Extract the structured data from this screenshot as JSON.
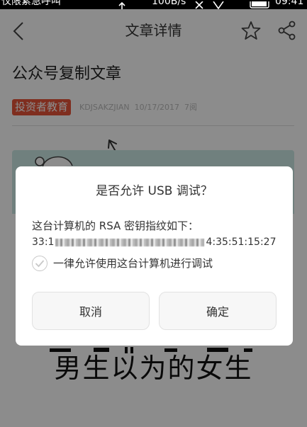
{
  "status_bar": {
    "carrier_text": "仅限紧急呼叫",
    "net_speed": "100B/s",
    "time": "09:41",
    "icons": [
      "upload-arrow-icon",
      "no-signal-icon",
      "wifi-icon",
      "battery-icon"
    ]
  },
  "header": {
    "title": "文章详情",
    "icons": [
      "back-chevron-icon",
      "star-icon",
      "share-icon"
    ]
  },
  "article": {
    "title": "公众号复制文章",
    "tag": "投资者教育",
    "meta": "KDJSAKZJIAN  10/17/2017  7阅",
    "image_caption": "男生以为的女生"
  },
  "dialog": {
    "title": "是否允许 USB 调试？",
    "description": "这台计算机的 RSA 密钥指纹如下：",
    "fingerprint_visible_start": "33:1",
    "fingerprint_visible_end": "4:35:51:15:27",
    "always_allow_label": "一律允许使用这台计算机进行调试",
    "always_allow_checked": false,
    "cancel_label": "取消",
    "confirm_label": "确定"
  },
  "colors": {
    "tag_accent": "#e8553a",
    "overlay": "rgba(0,0,0,0.45)",
    "image_band": "#cdeae6",
    "dialog_bg": "#ffffff",
    "button_bg": "#f7f7f7"
  }
}
